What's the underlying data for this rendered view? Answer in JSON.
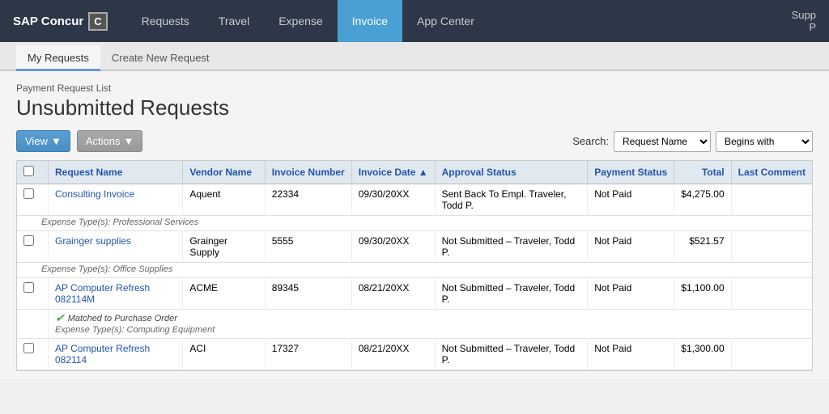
{
  "app": {
    "logo": "SAP Concur",
    "logo_box": "C",
    "nav_right_top": "Supp",
    "nav_right_bottom": "P"
  },
  "nav": {
    "links": [
      {
        "label": "Requests",
        "active": false
      },
      {
        "label": "Travel",
        "active": false
      },
      {
        "label": "Expense",
        "active": false
      },
      {
        "label": "Invoice",
        "active": true
      },
      {
        "label": "App Center",
        "active": false
      }
    ]
  },
  "sub_nav": {
    "links": [
      {
        "label": "My Requests",
        "active": true
      },
      {
        "label": "Create New Request",
        "active": false
      }
    ]
  },
  "main": {
    "breadcrumb": "Payment Request List",
    "page_title": "Unsubmitted Requests",
    "toolbar": {
      "view_label": "View",
      "actions_label": "Actions"
    },
    "search": {
      "label": "Search:",
      "field_value": "Request Name",
      "condition_value": "Begins with"
    },
    "table": {
      "columns": [
        "",
        "Request Name",
        "Vendor Name",
        "Invoice Number",
        "Invoice Date ▲",
        "Approval Status",
        "Payment Status",
        "Total",
        "Last Comment"
      ],
      "rows": [
        {
          "id": 1,
          "request_name": "Consulting Invoice",
          "vendor_name": "Aquent",
          "invoice_number": "22334",
          "invoice_date": "09/30/20XX",
          "approval_status": "Sent Back To Empl. Traveler, Todd P.",
          "payment_status": "Not Paid",
          "total": "$4,275.00",
          "last_comment": "",
          "sub_text": "Expense Type(s):  Professional Services",
          "matched_po": false
        },
        {
          "id": 2,
          "request_name": "Grainger supplies",
          "vendor_name": "Grainger Supply",
          "invoice_number": "5555",
          "invoice_date": "09/30/20XX",
          "approval_status": "Not Submitted – Traveler, Todd P.",
          "payment_status": "Not Paid",
          "total": "$521.57",
          "last_comment": "",
          "sub_text": "Expense Type(s):  Office Supplies",
          "matched_po": false
        },
        {
          "id": 3,
          "request_name": "AP Computer Refresh 082114M",
          "vendor_name": "ACME",
          "invoice_number": "89345",
          "invoice_date": "08/21/20XX",
          "approval_status": "Not Submitted – Traveler, Todd P.",
          "payment_status": "Not Paid",
          "total": "$1,100.00",
          "last_comment": "",
          "sub_text": "Expense Type(s):  Computing Equipment",
          "matched_po": true,
          "matched_po_text": "Matched to Purchase Order"
        },
        {
          "id": 4,
          "request_name": "AP Computer Refresh 082114",
          "vendor_name": "ACI",
          "invoice_number": "17327",
          "invoice_date": "08/21/20XX",
          "approval_status": "Not Submitted – Traveler, Todd P.",
          "payment_status": "Not Paid",
          "total": "$1,300.00",
          "last_comment": "",
          "sub_text": "",
          "matched_po": false
        }
      ]
    }
  }
}
